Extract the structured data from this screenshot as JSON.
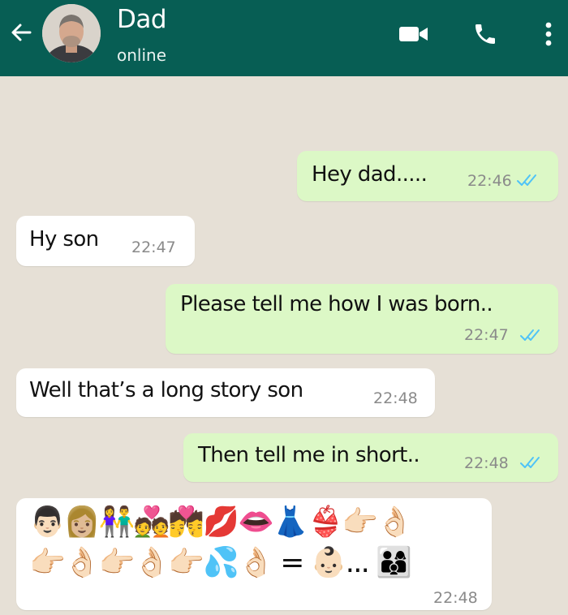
{
  "header": {
    "contact_name": "Dad",
    "status": "online",
    "icons": [
      "back-arrow-icon",
      "avatar",
      "video-call-icon",
      "voice-call-icon",
      "more-options-icon"
    ],
    "color": "#075e54"
  },
  "messages": [
    {
      "direction": "outgoing",
      "text": "Hey dad.....",
      "time": "22:46",
      "read": true
    },
    {
      "direction": "incoming",
      "text": "Hy son",
      "time": "22:47"
    },
    {
      "direction": "outgoing",
      "text": "Please tell me how I was born..",
      "time": "22:47",
      "read": true
    },
    {
      "direction": "incoming",
      "text": "Well that’s a long story son",
      "time": "22:48"
    },
    {
      "direction": "outgoing",
      "text": "Then tell me in short..",
      "time": "22:48",
      "read": true
    },
    {
      "direction": "incoming",
      "emoji_line_1": "👨🏻👩🏼👫💑💏💋👄👗👙👉🏻👌🏻",
      "emoji_line_2": "👉🏻👌🏻👉🏻👌🏻👉🏻💦👌🏻 = 👶🏻... 👨‍👩‍👦",
      "time": "22:48"
    }
  ],
  "colors": {
    "outgoing_bubble": "#dcf8c6",
    "incoming_bubble": "#ffffff",
    "chat_background": "#e6e0d6",
    "read_ticks": "#4fc3f7"
  }
}
